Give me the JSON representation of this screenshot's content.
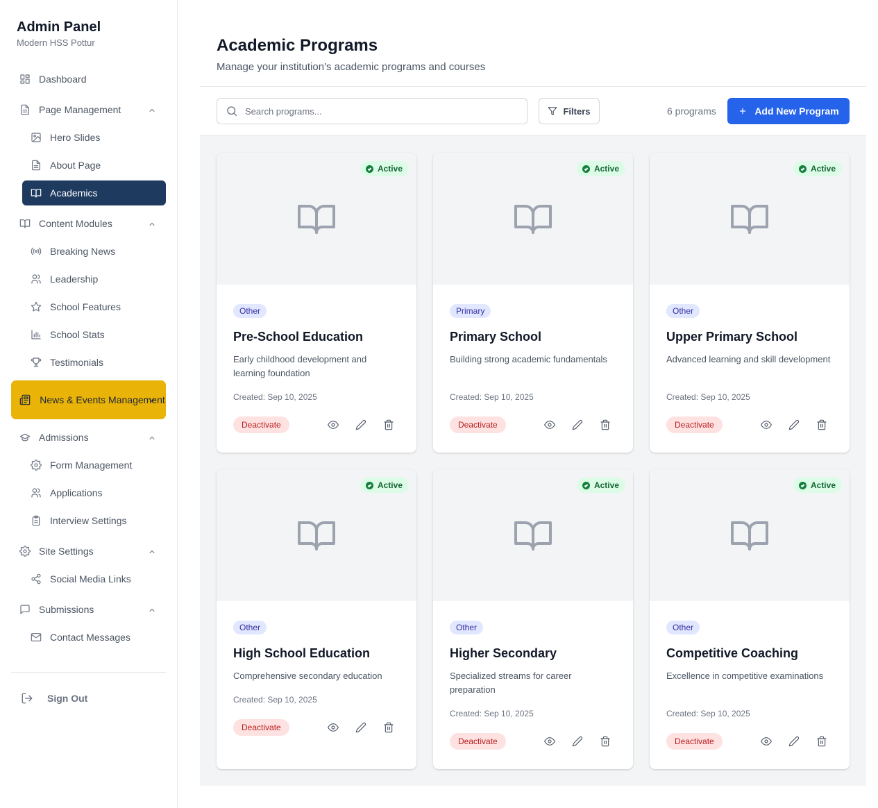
{
  "brand": {
    "title": "Admin Panel",
    "subtitle": "Modern HSS Pottur"
  },
  "nav": {
    "dashboard": "Dashboard",
    "page_management": "Page Management",
    "hero_slides": "Hero Slides",
    "about_page": "About Page",
    "academics": "Academics",
    "content_modules": "Content Modules",
    "breaking_news": "Breaking News",
    "leadership": "Leadership",
    "school_features": "School Features",
    "school_stats": "School Stats",
    "testimonials": "Testimonials",
    "news_events": "News & Events Management",
    "admissions": "Admissions",
    "form_management": "Form Management",
    "applications": "Applications",
    "interview_settings": "Interview Settings",
    "site_settings": "Site Settings",
    "social_media_links": "Social Media Links",
    "submissions": "Submissions",
    "contact_messages": "Contact Messages",
    "sign_out": "Sign Out"
  },
  "header": {
    "title": "Academic Programs",
    "subtitle": "Manage your institution's academic programs and courses"
  },
  "toolbar": {
    "search_placeholder": "Search programs...",
    "filters_label": "Filters",
    "count": "6 programs",
    "add_label": "Add New Program"
  },
  "programs": [
    {
      "status": "Active",
      "category": "Other",
      "title": "Pre-School Education",
      "description": "Early childhood development and learning foundation",
      "created": "Created: Sep 10, 2025",
      "action": "Deactivate"
    },
    {
      "status": "Active",
      "category": "Primary",
      "title": "Primary School",
      "description": "Building strong academic fundamentals",
      "created": "Created: Sep 10, 2025",
      "action": "Deactivate"
    },
    {
      "status": "Active",
      "category": "Other",
      "title": "Upper Primary School",
      "description": "Advanced learning and skill development",
      "created": "Created: Sep 10, 2025",
      "action": "Deactivate"
    },
    {
      "status": "Active",
      "category": "Other",
      "title": "High School Education",
      "description": "Comprehensive secondary education",
      "created": "Created: Sep 10, 2025",
      "action": "Deactivate"
    },
    {
      "status": "Active",
      "category": "Other",
      "title": "Higher Secondary",
      "description": "Specialized streams for career preparation",
      "created": "Created: Sep 10, 2025",
      "action": "Deactivate"
    },
    {
      "status": "Active",
      "category": "Other",
      "title": "Competitive Coaching",
      "description": "Excellence in competitive examinations",
      "created": "Created: Sep 10, 2025",
      "action": "Deactivate"
    }
  ],
  "colors": {
    "sidebar_active": "#1e3a5f",
    "sidebar_highlight": "#eab308",
    "primary": "#2563eb",
    "status_active": "#15803d",
    "category_badge": "#e0e7ff",
    "deactivate": "#b91c1c"
  }
}
